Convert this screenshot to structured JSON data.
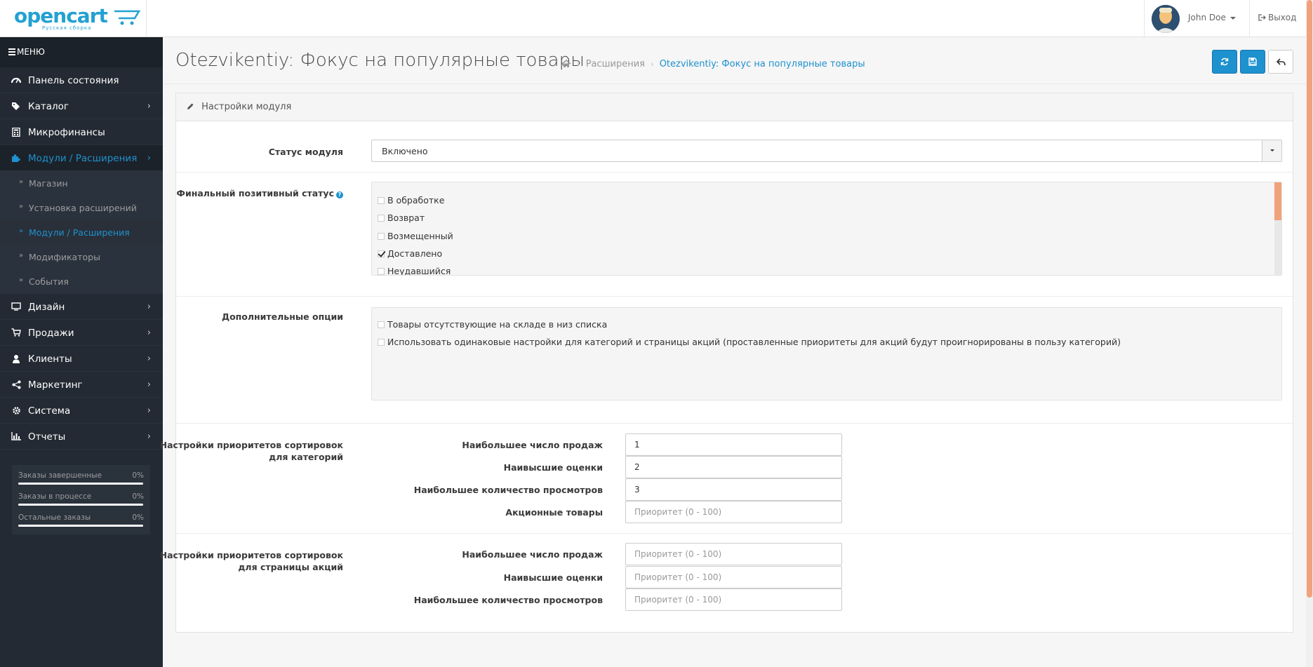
{
  "header": {
    "logo_text": "opencart",
    "logo_sub": "Русская сборка",
    "user_name": "John Doe",
    "logout_label": "Выход"
  },
  "sidebar": {
    "menu_label": "МЕНЮ",
    "items": [
      {
        "label": "Панель состояния",
        "icon": "dashboard-icon"
      },
      {
        "label": "Каталог",
        "icon": "tags-icon"
      },
      {
        "label": "Микрофинансы",
        "icon": "calculator-icon"
      },
      {
        "label": "Модули / Расширения",
        "icon": "puzzle-icon"
      },
      {
        "label": "Дизайн",
        "icon": "monitor-icon"
      },
      {
        "label": "Продажи",
        "icon": "cart-icon"
      },
      {
        "label": "Клиенты",
        "icon": "user-icon"
      },
      {
        "label": "Маркетинг",
        "icon": "share-icon"
      },
      {
        "label": "Система",
        "icon": "gear-icon"
      },
      {
        "label": "Отчеты",
        "icon": "bar-chart-icon"
      }
    ],
    "subitems": [
      {
        "label": "Магазин"
      },
      {
        "label": "Установка расширений"
      },
      {
        "label": "Модули / Расширения"
      },
      {
        "label": "Модификаторы"
      },
      {
        "label": "События"
      }
    ],
    "stats": [
      {
        "label": "Заказы завершенные",
        "value": "0%"
      },
      {
        "label": "Заказы в процессе",
        "value": "0%"
      },
      {
        "label": "Остальные заказы",
        "value": "0%"
      }
    ]
  },
  "page": {
    "title": "Otezvikentiy: Фокус на популярные товары",
    "breadcrumb": [
      "Расширения",
      "Otezvikentiy: Фокус на популярные товары"
    ]
  },
  "panel": {
    "title": "Настройки модуля",
    "status_label": "Статус модуля",
    "status_value": "Включено",
    "final_status_label": "Финальный позитивный статус",
    "final_statuses": [
      {
        "label": "В обработке",
        "checked": false
      },
      {
        "label": "Возврат",
        "checked": false
      },
      {
        "label": "Возмещенный",
        "checked": false
      },
      {
        "label": "Доставлено",
        "checked": true
      },
      {
        "label": "Неудавшийся",
        "checked": false
      }
    ],
    "extra_label": "Дополнительные опции",
    "extra_options": [
      {
        "label": "Товары отсутствующие на складе в низ списка",
        "checked": false
      },
      {
        "label": "Использовать одинаковые настройки для категорий и страницы акций (проставленные приоритеты для акций будут проигнорированы в пользу категорий)",
        "checked": false
      }
    ],
    "cat_label_1": "Настройки приоритетов сортировок",
    "cat_label_2": "для категорий",
    "cat_fields": [
      {
        "label": "Наибольшее число продаж",
        "value": "1",
        "placeholder": "Приоритет (0 - 100)"
      },
      {
        "label": "Наивысшие оценки",
        "value": "2",
        "placeholder": "Приоритет (0 - 100)"
      },
      {
        "label": "Наибольшее количество просмотров",
        "value": "3",
        "placeholder": "Приоритет (0 - 100)"
      },
      {
        "label": "Акционные товары",
        "value": "",
        "placeholder": "Приоритет (0 - 100)"
      }
    ],
    "spec_label_1": "Настройки приоритетов сортировок",
    "spec_label_2": "для страницы акций",
    "spec_fields": [
      {
        "label": "Наибольшее число продаж",
        "value": "",
        "placeholder": "Приоритет (0 - 100)"
      },
      {
        "label": "Наивысшие оценки",
        "value": "",
        "placeholder": "Приоритет (0 - 100)"
      },
      {
        "label": "Наибольшее количество просмотров",
        "value": "",
        "placeholder": "Приоритет (0 - 100)"
      }
    ]
  },
  "colors": {
    "accent": "#1e91cf",
    "sidebar_bg": "#232a33",
    "scroll_thumb": "#f0a27c"
  }
}
